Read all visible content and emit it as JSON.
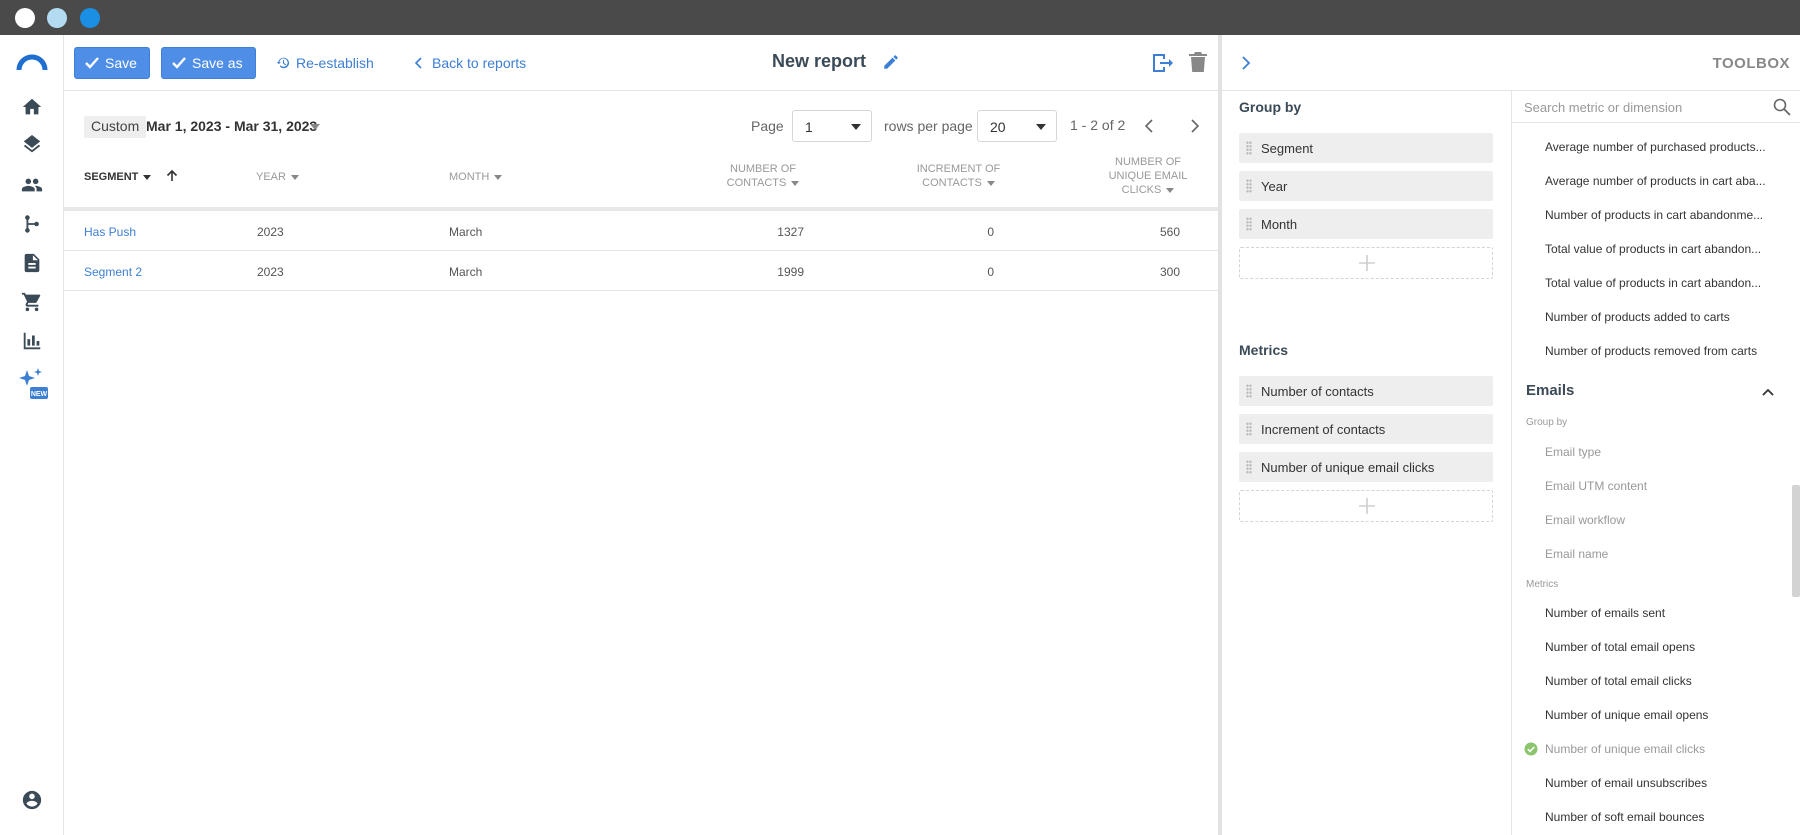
{
  "topbar": {
    "save_label": "Save",
    "save_as_label": "Save as",
    "reestablish_label": "Re-establish",
    "back_label": "Back to reports",
    "report_title": "New report"
  },
  "filters": {
    "custom_label": "Custom",
    "date_range": "Mar 1, 2023 - Mar 31, 2023",
    "page_label": "Page",
    "page_value": "1",
    "rows_per_page_label": "rows per page",
    "rows_per_page_value": "20",
    "range_text": "1 - 2 of 2"
  },
  "table": {
    "columns": [
      {
        "label": "SEGMENT"
      },
      {
        "label": "YEAR"
      },
      {
        "label": "MONTH"
      },
      {
        "label": "NUMBER OF CONTACTS"
      },
      {
        "label": "INCREMENT OF CONTACTS"
      },
      {
        "label": "NUMBER OF UNIQUE EMAIL CLICKS"
      }
    ],
    "rows": [
      {
        "segment": "Has Push",
        "year": "2023",
        "month": "March",
        "contacts": "1327",
        "increment": "0",
        "clicks": "560"
      },
      {
        "segment": "Segment 2",
        "year": "2023",
        "month": "March",
        "contacts": "1999",
        "increment": "0",
        "clicks": "300"
      }
    ]
  },
  "toolbox": {
    "title": "TOOLBOX",
    "group_by_title": "Group by",
    "group_by_items": [
      "Segment",
      "Year",
      "Month"
    ],
    "metrics_title": "Metrics",
    "metrics_items": [
      "Number of contacts",
      "Increment of contacts",
      "Number of unique email clicks"
    ],
    "search_placeholder": "Search metric or dimension",
    "library_top_items": [
      "Average number of purchased products...",
      "Average number of products in cart aba...",
      "Number of products in cart abandonme...",
      "Total value of products in cart abandon...",
      "Total value of products in cart abandon...",
      "Number of products added to carts",
      "Number of products removed from carts"
    ],
    "emails_section": "Emails",
    "emails_group_by_label": "Group by",
    "emails_group_by": [
      "Email type",
      "Email UTM content",
      "Email workflow",
      "Email name"
    ],
    "emails_metrics_label": "Metrics",
    "emails_metrics": [
      "Number of emails sent",
      "Number of total email opens",
      "Number of total email clicks",
      "Number of unique email opens",
      "Number of unique email clicks",
      "Number of email unsubscribes",
      "Number of soft email bounces"
    ],
    "selected_metric_index": 4
  },
  "sidebar": {
    "new_badge": "NEW",
    "icons": [
      "home-icon",
      "layers-icon",
      "contacts-icon",
      "workflow-icon",
      "document-icon",
      "cart-icon",
      "reports-icon",
      "ai-sparkle-icon",
      "account-icon"
    ]
  },
  "colors": {
    "accent": "#4f8ee6",
    "link": "#3d7fd4",
    "titlebar": "#4a4a4a",
    "success": "#5cb85c"
  }
}
